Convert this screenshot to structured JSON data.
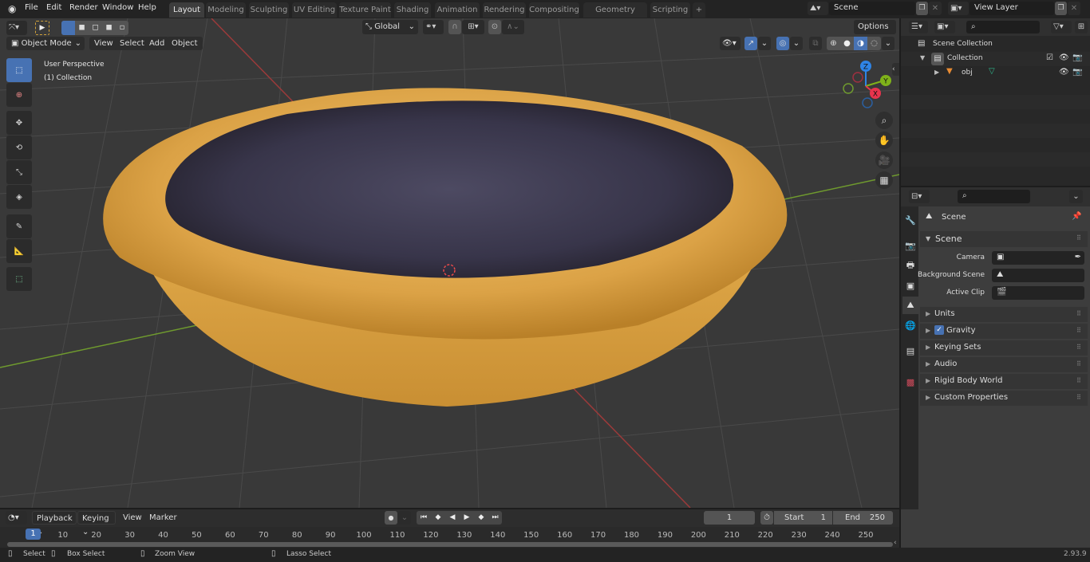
{
  "menu": [
    "File",
    "Edit",
    "Render",
    "Window",
    "Help"
  ],
  "workspaces": [
    {
      "label": "Layout",
      "active": true
    },
    {
      "label": "Modeling"
    },
    {
      "label": "Sculpting"
    },
    {
      "label": "UV Editing"
    },
    {
      "label": "Texture Paint"
    },
    {
      "label": "Shading"
    },
    {
      "label": "Animation"
    },
    {
      "label": "Rendering"
    },
    {
      "label": "Compositing"
    },
    {
      "label": "Geometry Nodes"
    },
    {
      "label": "Scripting"
    }
  ],
  "add_workspace": "+",
  "scene_name": "Scene",
  "view_layer_name": "View Layer",
  "toolbar": {
    "transform_orientation": "Global",
    "options_label": "Options"
  },
  "viewport_header": {
    "mode": "Object Mode",
    "menus": [
      "View",
      "Select",
      "Add",
      "Object"
    ]
  },
  "viewport_overlay": {
    "view_name": "User Perspective",
    "collection": "(1) Collection"
  },
  "gizmo": {
    "z": "Z",
    "y": "Y",
    "x": "X"
  },
  "outliner": {
    "root": "Scene Collection",
    "collection": "Collection",
    "object": "obj"
  },
  "properties": {
    "context_label": "Scene",
    "panel_title": "Scene",
    "fields": [
      {
        "label": "Camera",
        "value": ""
      },
      {
        "label": "Background Scene",
        "value": ""
      },
      {
        "label": "Active Clip",
        "value": ""
      }
    ],
    "subpanels": [
      {
        "label": "Units"
      },
      {
        "label": "Gravity",
        "checked": true
      },
      {
        "label": "Keying Sets"
      },
      {
        "label": "Audio"
      },
      {
        "label": "Rigid Body World"
      },
      {
        "label": "Custom Properties"
      }
    ]
  },
  "timeline": {
    "menus": [
      "Playback",
      "Keying",
      "View",
      "Marker"
    ],
    "current_frame": "1",
    "start_label": "Start",
    "start": "1",
    "end_label": "End",
    "end": "250",
    "ticks": [
      "10",
      "20",
      "30",
      "40",
      "50",
      "60",
      "70",
      "80",
      "90",
      "100",
      "110",
      "120",
      "130",
      "140",
      "150",
      "160",
      "170",
      "180",
      "190",
      "200",
      "210",
      "220",
      "230",
      "240",
      "250"
    ],
    "playhead": "1"
  },
  "statusbar": {
    "select": "Select",
    "box_select": "Box Select",
    "zoom_view": "Zoom View",
    "lasso_select": "Lasso Select",
    "version": "2.93.9"
  },
  "colors": {
    "accent": "#4772b3",
    "x_axis": "#e8344d",
    "y_axis": "#7fb21a",
    "z_axis": "#2f84e6",
    "crust": "#d9a040",
    "filling": "#3a3648"
  }
}
